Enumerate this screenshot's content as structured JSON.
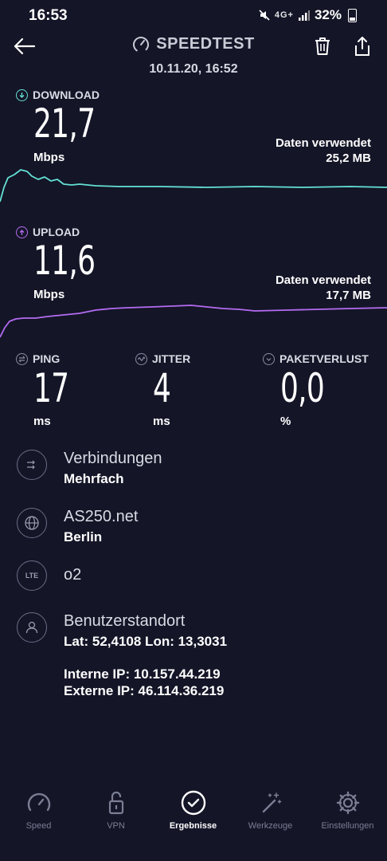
{
  "status_bar": {
    "time": "16:53",
    "network": "4G+",
    "battery": "32%"
  },
  "header": {
    "title": "SPEEDTEST",
    "date": "10.11.20, 16:52"
  },
  "download": {
    "label": "DOWNLOAD",
    "value": "21,7",
    "unit": "Mbps",
    "data_used_label": "Daten verwendet",
    "data_used_value": "25,2 MB",
    "color": "#64e1d5"
  },
  "upload": {
    "label": "UPLOAD",
    "value": "11,6",
    "unit": "Mbps",
    "data_used_label": "Daten verwendet",
    "data_used_value": "17,7 MB",
    "color": "#b46cf2"
  },
  "ping": {
    "label": "PING",
    "value": "17",
    "unit": "ms"
  },
  "jitter": {
    "label": "JITTER",
    "value": "4",
    "unit": "ms"
  },
  "packet_loss": {
    "label": "PAKETVERLUST",
    "value": "0,0",
    "unit": "%"
  },
  "info": {
    "connections": {
      "title": "Verbindungen",
      "value": "Mehrfach"
    },
    "server": {
      "title": "AS250.net",
      "value": "Berlin"
    },
    "provider": {
      "icon_text": "LTE",
      "title": "o2"
    },
    "location": {
      "title": "Benutzerstandort",
      "coords": "Lat: 52,4108 Lon: 13,3031",
      "internal_ip": "Interne IP: 10.157.44.219",
      "external_ip": "Externe IP: 46.114.36.219"
    }
  },
  "nav": {
    "items": [
      {
        "label": "Speed",
        "icon": "speedometer-icon"
      },
      {
        "label": "VPN",
        "icon": "unlock-icon"
      },
      {
        "label": "Ergebnisse",
        "icon": "check-circle-icon"
      },
      {
        "label": "Werkzeuge",
        "icon": "magic-wand-icon"
      },
      {
        "label": "Einstellungen",
        "icon": "gear-icon"
      }
    ],
    "active_index": 2
  }
}
